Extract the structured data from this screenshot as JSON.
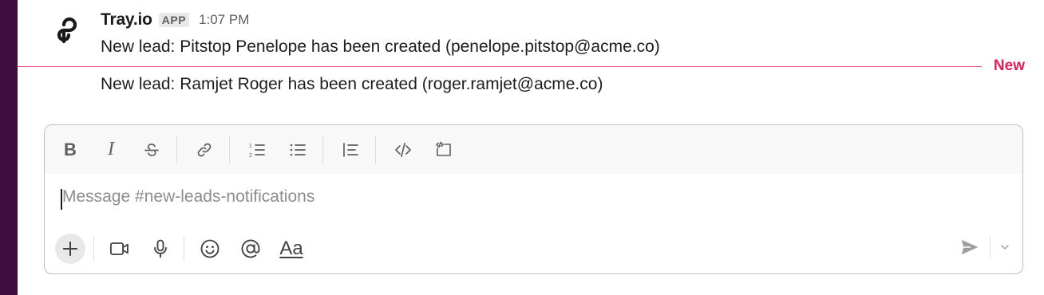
{
  "messages": [
    {
      "sender": "Tray.io",
      "badge": "APP",
      "timestamp": "1:07 PM",
      "text": "New lead: Pitstop Penelope has been created (penelope.pitstop@acme.co)",
      "avatar_icon": "tray-io-logo"
    },
    {
      "text": "New lead: Ramjet Roger has been created (roger.ramjet@acme.co)"
    }
  ],
  "divider": {
    "label": "New",
    "color": "#e01e5a"
  },
  "composer": {
    "placeholder": "Message #new-leads-notifications",
    "format_buttons": [
      "bold-icon",
      "italic-icon",
      "strikethrough-icon",
      "link-icon",
      "ordered-list-icon",
      "bulleted-list-icon",
      "blockquote-icon",
      "code-icon",
      "code-block-icon"
    ],
    "action_buttons": [
      "plus-icon",
      "video-icon",
      "microphone-icon",
      "emoji-icon",
      "mention-icon",
      "formatting-icon"
    ],
    "bold_label": "B",
    "italic_label": "I",
    "formatting_label": "Aa"
  },
  "colors": {
    "sidebar": "#3f0e40",
    "accent_new": "#e01e5a"
  }
}
